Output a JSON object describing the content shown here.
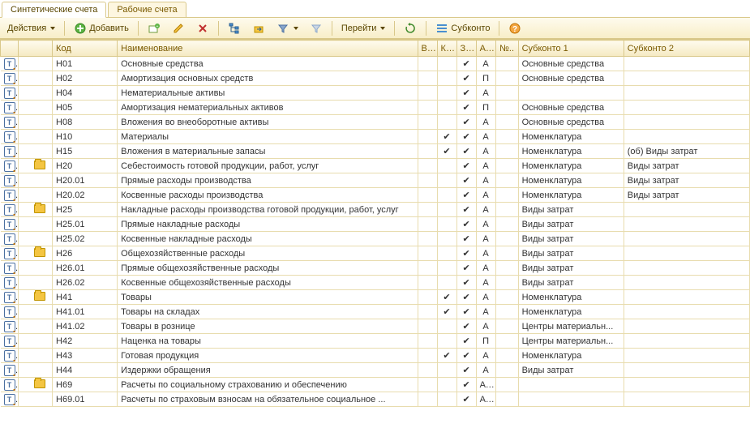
{
  "tabs": [
    {
      "label": "Синтетические счета",
      "active": true
    },
    {
      "label": "Рабочие счета",
      "active": false
    }
  ],
  "toolbar": {
    "actions": "Действия",
    "add": "Добавить",
    "goto": "Перейти",
    "subkonto": "Субконто"
  },
  "columns": {
    "code": "Код",
    "name": "Наименование",
    "b": "В...",
    "k": "К...",
    "z": "З...",
    "a": "А...",
    "no": "№..",
    "sk1": "Субконто 1",
    "sk2": "Субконто 2"
  },
  "rows": [
    {
      "folder": false,
      "code": "Н01",
      "name": "Основные средства",
      "b": "",
      "k": "",
      "z": "v",
      "a": "А",
      "sk1": "Основные средства",
      "sk2": ""
    },
    {
      "folder": false,
      "code": "Н02",
      "name": "Амортизация основных средств",
      "b": "",
      "k": "",
      "z": "v",
      "a": "П",
      "sk1": "Основные средства",
      "sk2": ""
    },
    {
      "folder": false,
      "code": "Н04",
      "name": "Нематериальные активы",
      "b": "",
      "k": "",
      "z": "v",
      "a": "А",
      "sk1": "",
      "sk2": ""
    },
    {
      "folder": false,
      "code": "Н05",
      "name": "Амортизация нематериальных активов",
      "b": "",
      "k": "",
      "z": "v",
      "a": "П",
      "sk1": "Основные средства",
      "sk2": ""
    },
    {
      "folder": false,
      "code": "Н08",
      "name": "Вложения во внеоборотные активы",
      "b": "",
      "k": "",
      "z": "v",
      "a": "А",
      "sk1": "Основные средства",
      "sk2": ""
    },
    {
      "folder": false,
      "code": "Н10",
      "name": "Материалы",
      "b": "",
      "k": "v",
      "z": "v",
      "a": "А",
      "sk1": "Номенклатура",
      "sk2": ""
    },
    {
      "folder": false,
      "code": "Н15",
      "name": "Вложения в материальные запасы",
      "b": "",
      "k": "v",
      "z": "v",
      "a": "А",
      "sk1": "Номенклатура",
      "sk2": "(об) Виды затрат"
    },
    {
      "folder": true,
      "code": "Н20",
      "name": "Себестоимость готовой продукции, работ, услуг",
      "b": "",
      "k": "",
      "z": "v",
      "a": "А",
      "sk1": "Номенклатура",
      "sk2": "Виды затрат"
    },
    {
      "folder": false,
      "code": "Н20.01",
      "name": "Прямые расходы производства",
      "b": "",
      "k": "",
      "z": "v",
      "a": "А",
      "sk1": "Номенклатура",
      "sk2": "Виды затрат"
    },
    {
      "folder": false,
      "code": "Н20.02",
      "name": "Косвенные расходы производства",
      "b": "",
      "k": "",
      "z": "v",
      "a": "А",
      "sk1": "Номенклатура",
      "sk2": "Виды затрат"
    },
    {
      "folder": true,
      "code": "Н25",
      "name": "Накладные расходы производства готовой продукции, работ, услуг",
      "b": "",
      "k": "",
      "z": "v",
      "a": "А",
      "sk1": "Виды затрат",
      "sk2": ""
    },
    {
      "folder": false,
      "code": "Н25.01",
      "name": "Прямые накладные расходы",
      "b": "",
      "k": "",
      "z": "v",
      "a": "А",
      "sk1": "Виды затрат",
      "sk2": ""
    },
    {
      "folder": false,
      "code": "Н25.02",
      "name": "Косвенные накладные расходы",
      "b": "",
      "k": "",
      "z": "v",
      "a": "А",
      "sk1": "Виды затрат",
      "sk2": ""
    },
    {
      "folder": true,
      "code": "Н26",
      "name": "Общехозяйственные расходы",
      "b": "",
      "k": "",
      "z": "v",
      "a": "А",
      "sk1": "Виды затрат",
      "sk2": ""
    },
    {
      "folder": false,
      "code": "Н26.01",
      "name": "Прямые общехозяйственные расходы",
      "b": "",
      "k": "",
      "z": "v",
      "a": "А",
      "sk1": "Виды затрат",
      "sk2": ""
    },
    {
      "folder": false,
      "code": "Н26.02",
      "name": "Косвенные общехозяйственные расходы",
      "b": "",
      "k": "",
      "z": "v",
      "a": "А",
      "sk1": "Виды затрат",
      "sk2": ""
    },
    {
      "folder": true,
      "code": "Н41",
      "name": "Товары",
      "b": "",
      "k": "v",
      "z": "v",
      "a": "А",
      "sk1": "Номенклатура",
      "sk2": ""
    },
    {
      "folder": false,
      "code": "Н41.01",
      "name": "Товары на складах",
      "b": "",
      "k": "v",
      "z": "v",
      "a": "А",
      "sk1": "Номенклатура",
      "sk2": ""
    },
    {
      "folder": false,
      "code": "Н41.02",
      "name": "Товары в рознице",
      "b": "",
      "k": "",
      "z": "v",
      "a": "А",
      "sk1": "Центры материальн...",
      "sk2": ""
    },
    {
      "folder": false,
      "code": "Н42",
      "name": "Наценка на товары",
      "b": "",
      "k": "",
      "z": "v",
      "a": "П",
      "sk1": "Центры материальн...",
      "sk2": ""
    },
    {
      "folder": false,
      "code": "Н43",
      "name": "Готовая продукция",
      "b": "",
      "k": "v",
      "z": "v",
      "a": "А",
      "sk1": "Номенклатура",
      "sk2": ""
    },
    {
      "folder": false,
      "code": "Н44",
      "name": "Издержки обращения",
      "b": "",
      "k": "",
      "z": "v",
      "a": "А",
      "sk1": "Виды затрат",
      "sk2": ""
    },
    {
      "folder": true,
      "code": "Н69",
      "name": "Расчеты по социальному страхованию и обеспечению",
      "b": "",
      "k": "",
      "z": "v",
      "a": "АП",
      "sk1": "",
      "sk2": ""
    },
    {
      "folder": false,
      "code": "Н69.01",
      "name": "Расчеты по страховым взносам на обязательное социальное ...",
      "b": "",
      "k": "",
      "z": "v",
      "a": "АП",
      "sk1": "",
      "sk2": ""
    }
  ]
}
